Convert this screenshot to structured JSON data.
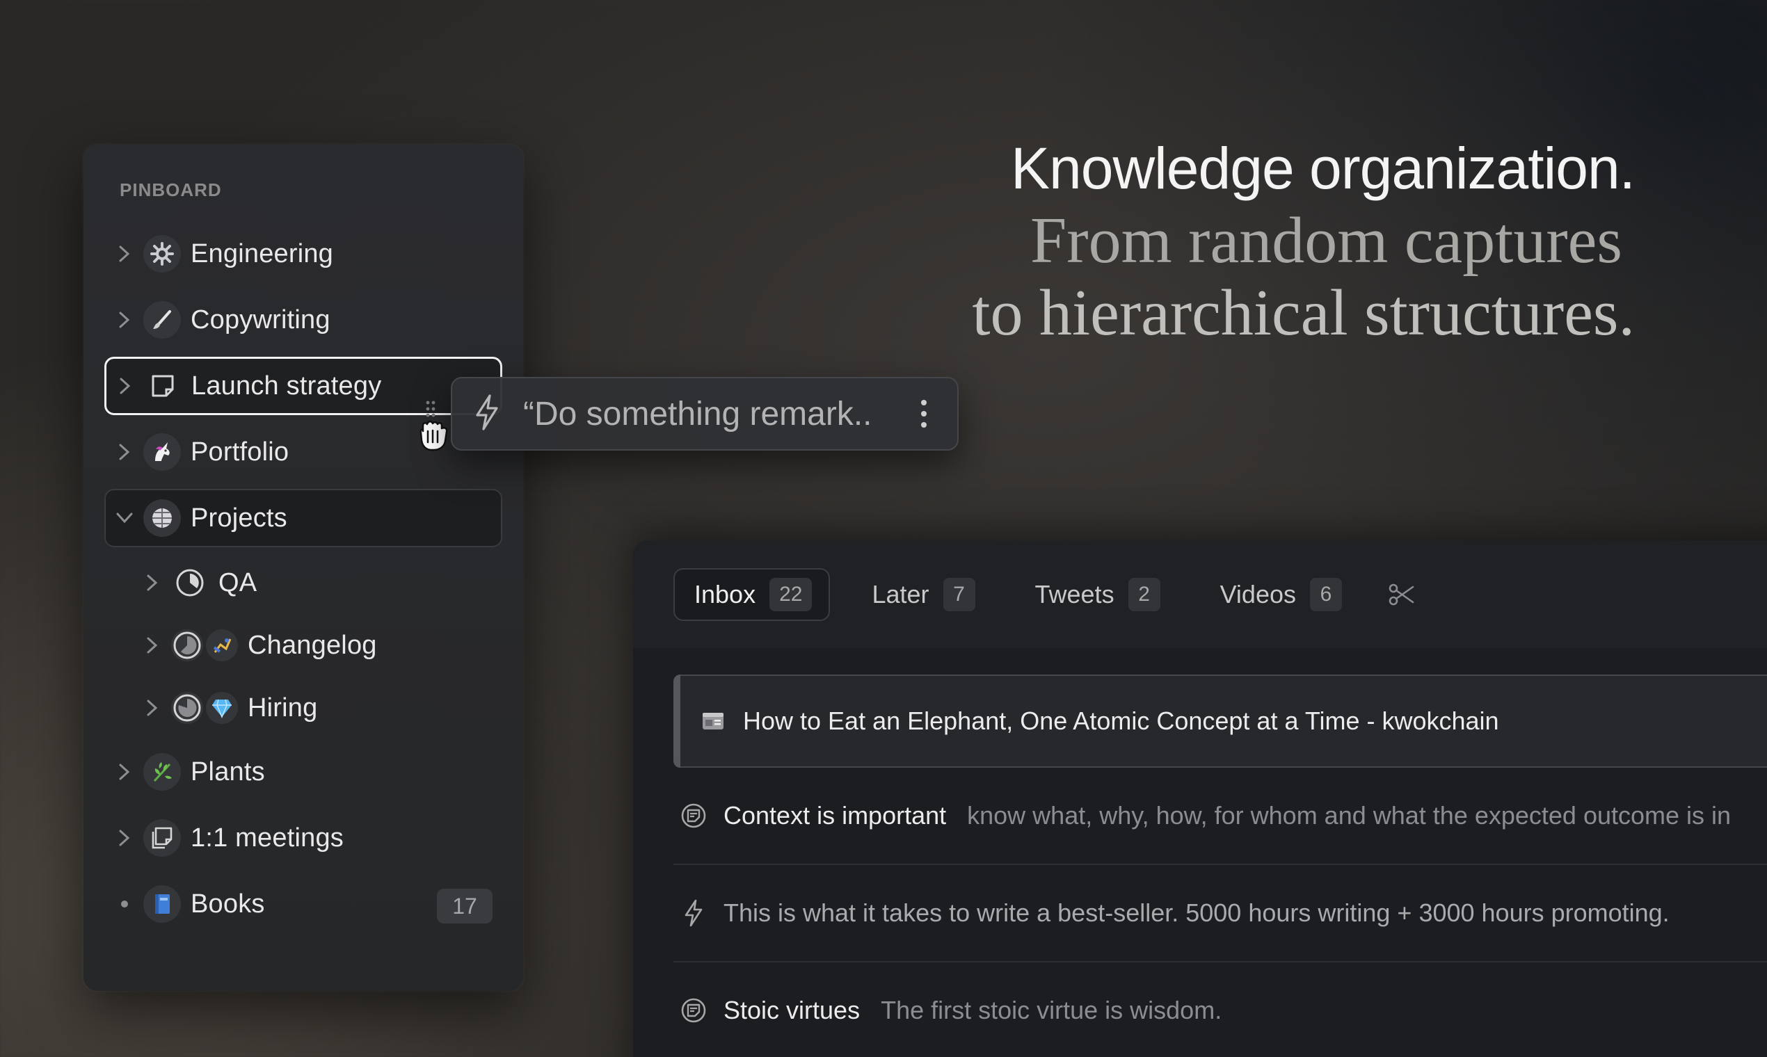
{
  "hero": {
    "line1": "Knowledge organization.",
    "line2": "From random captures",
    "line3": "to hierarchical structures."
  },
  "sidebar": {
    "title": "PINBOARD",
    "items": [
      {
        "label": "Engineering",
        "icon": "gear-icon"
      },
      {
        "label": "Copywriting",
        "icon": "brush-icon"
      },
      {
        "label": "Launch strategy",
        "icon": "note-icon",
        "state": "selected"
      },
      {
        "label": "Portfolio",
        "icon": "unicorn-icon"
      },
      {
        "label": "Projects",
        "icon": "globe-icon",
        "state": "expanded"
      },
      {
        "label": "QA",
        "icon": "progress-icon"
      },
      {
        "label": "Changelog",
        "icon": "progress-icon"
      },
      {
        "label": "Hiring",
        "icon": "diamond-icon"
      },
      {
        "label": "Plants",
        "icon": "herb-icon"
      },
      {
        "label": "1:1 meetings",
        "icon": "stacked-notes-icon"
      },
      {
        "label": "Books",
        "icon": "book-icon",
        "count": "17"
      }
    ]
  },
  "drag_card": {
    "text": "“Do something remark.."
  },
  "tabs": [
    {
      "label": "Inbox",
      "count": "22",
      "active": true
    },
    {
      "label": "Later",
      "count": "7"
    },
    {
      "label": "Tweets",
      "count": "2"
    },
    {
      "label": "Videos",
      "count": "6"
    }
  ],
  "rows": [
    {
      "title": "How to Eat an Elephant, One Atomic Concept at a Time - kwokchain",
      "desc": "",
      "icon": "webpage-icon"
    },
    {
      "title": "Context is important",
      "desc": "know what, why, how, for whom and what the expected outcome is in",
      "icon": "note-icon"
    },
    {
      "title": "This is what it takes to write a best-seller. 5000 hours writing + 3000 hours promoting.",
      "desc": "",
      "icon": "lightning-icon"
    },
    {
      "title": "Stoic virtues",
      "desc": "The first stoic virtue is wisdom.",
      "icon": "note-icon"
    }
  ],
  "colors": {
    "background": "#2a2826",
    "panel": "#1c1d20",
    "sidebar": "#2a2b2e",
    "selected_border": "#f2f2f2"
  }
}
